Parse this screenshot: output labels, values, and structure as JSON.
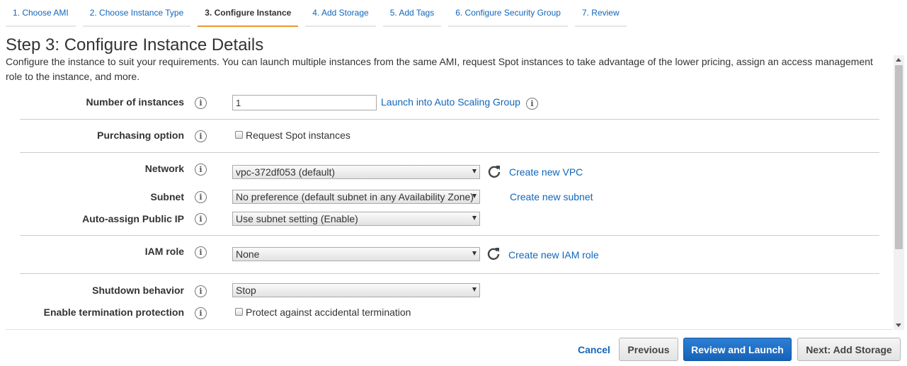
{
  "tabs": [
    {
      "label": "1. Choose AMI"
    },
    {
      "label": "2. Choose Instance Type"
    },
    {
      "label": "3. Configure Instance"
    },
    {
      "label": "4. Add Storage"
    },
    {
      "label": "5. Add Tags"
    },
    {
      "label": "6. Configure Security Group"
    },
    {
      "label": "7. Review"
    }
  ],
  "active_tab": "3. Configure Instance",
  "header": {
    "title": "Step 3: Configure Instance Details",
    "description": "Configure the instance to suit your requirements. You can launch multiple instances from the same AMI, request Spot instances to take advantage of the lower pricing, assign an access management role to the instance, and more."
  },
  "form": {
    "number_of_instances": {
      "label": "Number of instances",
      "value": "1",
      "link": "Launch into Auto Scaling Group"
    },
    "purchasing_option": {
      "label": "Purchasing option",
      "checkbox_label": "Request Spot instances",
      "checked": false
    },
    "network": {
      "label": "Network",
      "value": "vpc-372df053 (default)",
      "link": "Create new VPC"
    },
    "subnet": {
      "label": "Subnet",
      "value": "No preference (default subnet in any Availability Zone)",
      "link": "Create new subnet"
    },
    "public_ip": {
      "label": "Auto-assign Public IP",
      "value": "Use subnet setting (Enable)"
    },
    "iam_role": {
      "label": "IAM role",
      "value": "None",
      "link": "Create new IAM role"
    },
    "shutdown": {
      "label": "Shutdown behavior",
      "value": "Stop"
    },
    "termination": {
      "label": "Enable termination protection",
      "checkbox_label": "Protect against accidental termination",
      "checked": false
    }
  },
  "info_glyph": "i",
  "footer": {
    "cancel": "Cancel",
    "previous": "Previous",
    "review_launch": "Review and Launch",
    "next": "Next: Add Storage"
  },
  "colors": {
    "link": "#1166bb",
    "active_tab_underline": "#ec9630",
    "primary_button": "#1563b9"
  }
}
